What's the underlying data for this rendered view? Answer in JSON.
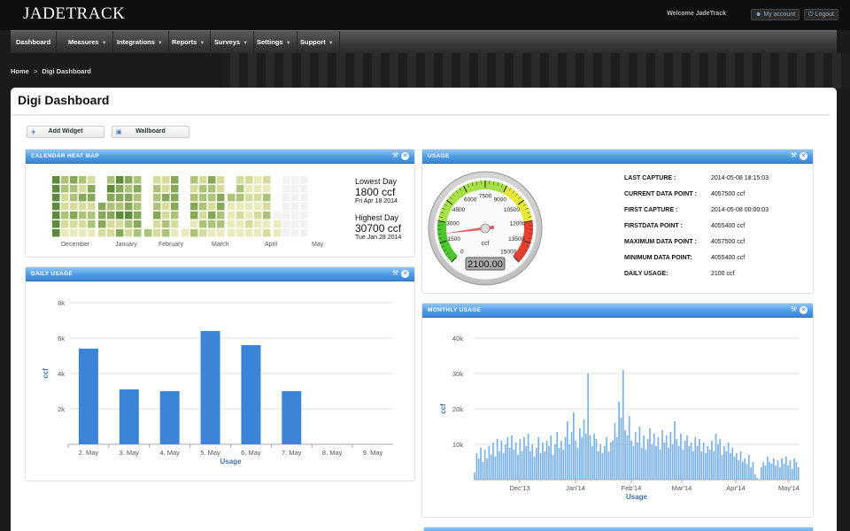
{
  "app": {
    "logo": "JADETRACK",
    "welcome": "Welcome JadeTrack",
    "my_account": "My account",
    "logout": "Logout"
  },
  "nav": {
    "items": [
      {
        "label": "Dashboard",
        "has_menu": false
      },
      {
        "label": "Measures",
        "has_menu": true
      },
      {
        "label": "Integrations",
        "has_menu": true
      },
      {
        "label": "Reports",
        "has_menu": true
      },
      {
        "label": "Surveys",
        "has_menu": true
      },
      {
        "label": "Settings",
        "has_menu": true
      },
      {
        "label": "Support",
        "has_menu": true
      }
    ]
  },
  "breadcrumb": {
    "home": "Home",
    "separator": ">",
    "current": "Digi Dashboard"
  },
  "page": {
    "title": "Digi Dashboard"
  },
  "toolbar": {
    "add_widget": "Add Widget",
    "wallboard": "Wallboard"
  },
  "colors": {
    "accent": "#4a90d9",
    "bar": "#3b84d8",
    "monthly_bar": "#7eb3e6"
  },
  "heatmap": {
    "title": "CALENDAR HEAT MAP",
    "months": [
      "December",
      "January",
      "February",
      "March",
      "April",
      "May"
    ],
    "lowest_label": "Lowest Day",
    "lowest_value": "1800 ccf",
    "lowest_date": "Fri Apr 18 2014",
    "highest_label": "Highest Day",
    "highest_value": "30700 ccf",
    "highest_date": "Tue Jan 28 2014",
    "palette": [
      "#f2f2f2",
      "#e9ebbd",
      "#d6dd9c",
      "#aec37a",
      "#86a858",
      "#5e8a3c"
    ]
  },
  "gauge": {
    "title": "USAGE",
    "value": 2100,
    "display": "2100.00",
    "unit": "ccf",
    "min": 0,
    "max": 15000,
    "ticks": [
      "0",
      "1500",
      "3000",
      "4500",
      "6000",
      "7500",
      "9000",
      "10500",
      "12000",
      "13500",
      "15000"
    ],
    "details": [
      {
        "label": "LAST CAPTURE :",
        "value": "2014-05-08 18:15:03"
      },
      {
        "label": "CURRENT DATA POINT :",
        "value": "4057500 ccf"
      },
      {
        "label": "FIRST CAPTURE :",
        "value": "2014-05-08 00:00:03"
      },
      {
        "label": "FIRSTDATA POINT :",
        "value": "4055400 ccf"
      },
      {
        "label": "MAXIMUM DATA POINT :",
        "value": "4057500 ccf"
      },
      {
        "label": "MINIMUM DATA POINT:",
        "value": "4055400 ccf"
      },
      {
        "label": "DAILY USAGE:",
        "value": "2100 ccf"
      }
    ]
  },
  "daily": {
    "title": "DAILY USAGE",
    "chart_data": {
      "type": "bar",
      "categories": [
        "2. May",
        "3. May",
        "4. May",
        "5. May",
        "6. May",
        "7. May",
        "8. May",
        "9. May"
      ],
      "values": [
        5400,
        3100,
        3000,
        6400,
        5600,
        3000,
        0,
        0
      ],
      "yticks": [
        "2k",
        "4k",
        "6k",
        "8k"
      ],
      "ylim": [
        0,
        8000
      ],
      "xlabel": "Usage",
      "ylabel": "ccf"
    }
  },
  "monthly": {
    "title": "MONTHLY USAGE",
    "chart_data": {
      "type": "bar",
      "xticks": [
        "Dec'13",
        "Jan'14",
        "Feb'14",
        "Mar'14",
        "Apr'14",
        "May'14"
      ],
      "yticks": [
        "10k",
        "20k",
        "30k",
        "40k"
      ],
      "ylim": [
        0,
        40000
      ],
      "xlabel": "Usage",
      "ylabel": "ccf",
      "values": [
        2000,
        7500,
        6000,
        9000,
        5000,
        8500,
        6000,
        9500,
        7000,
        10500,
        6500,
        11500,
        8000,
        11000,
        7500,
        10000,
        12000,
        9000,
        12500,
        8500,
        10500,
        7000,
        11500,
        8000,
        12000,
        9500,
        13000,
        8000,
        10000,
        6500,
        9000,
        12000,
        7500,
        10500,
        8000,
        11000,
        9500,
        12500,
        7000,
        10000,
        13500,
        9000,
        11000,
        8500,
        12000,
        16500,
        10000,
        13500,
        19000,
        11000,
        9000,
        14500,
        12000,
        17000,
        13000,
        30000,
        12500,
        9500,
        13000,
        11500,
        8000,
        10000,
        7500,
        9500,
        12000,
        8000,
        10500,
        11000,
        16000,
        12000,
        22000,
        17500,
        31000,
        14000,
        12500,
        18000,
        11000,
        9500,
        13500,
        10500,
        15000,
        9000,
        12500,
        8500,
        11500,
        14500,
        10000,
        13000,
        9500,
        12000,
        8500,
        14000,
        10500,
        12500,
        9000,
        13500,
        10000,
        16500,
        11500,
        9500,
        13000,
        8500,
        11000,
        12500,
        9500,
        10500,
        8000,
        12000,
        9500,
        11500,
        8000,
        10500,
        7500,
        9500,
        8500,
        11000,
        8000,
        13000,
        10000,
        11500,
        7000,
        9500,
        8000,
        10500,
        7500,
        9000,
        6500,
        7500,
        5500,
        8000,
        5000,
        6000,
        4500,
        7000,
        3500,
        5000,
        1500,
        500,
        0,
        3500,
        5000,
        4000,
        6500,
        5000,
        4500,
        6000,
        4000,
        5500,
        3500,
        6000,
        4500,
        6500,
        4000,
        5500,
        3000,
        6000,
        5000,
        3500
      ]
    }
  }
}
